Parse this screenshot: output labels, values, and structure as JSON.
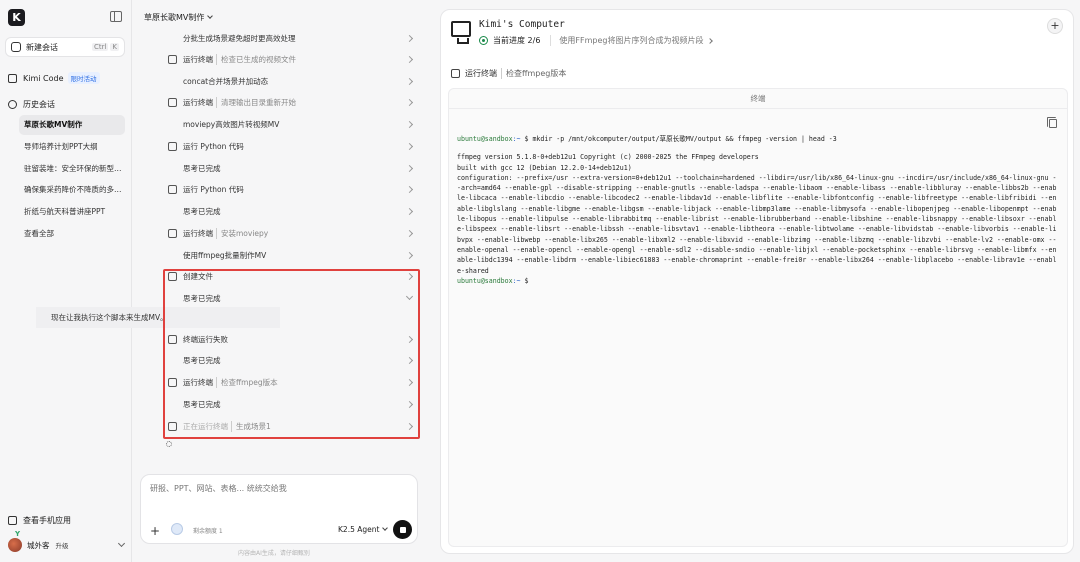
{
  "sidebar": {
    "logo": "K",
    "new_chat": {
      "label": "新建会话",
      "kbd1": "Ctrl",
      "kbd2": "K"
    },
    "kimi_code": {
      "label": "Kimi Code",
      "badge": "限时活动"
    },
    "history_label": "历史会话",
    "history": [
      "草原长歌MV制作",
      "导师培养计划PPT大纲",
      "驻留装堆：安全环保的新型…",
      "确保集采药降价不降质的多…",
      "折纸与航天科普讲座PPT",
      "查看全部"
    ],
    "mobile_app": "查看手机应用",
    "user": {
      "name": "城外客",
      "upgrade": "升级",
      "mark": "Y"
    }
  },
  "chat": {
    "title": "草原长歌MV制作",
    "steps": [
      {
        "icon": "none",
        "text": "分批生成场景避免超时更高效处理",
        "sub": ""
      },
      {
        "icon": "terminal",
        "text": "运行终端",
        "sub": "检查已生成的视频文件"
      },
      {
        "icon": "none",
        "text": "concat合并场景并加动态",
        "sub": ""
      },
      {
        "icon": "terminal",
        "text": "运行终端",
        "sub": "清理输出目录重新开始"
      },
      {
        "icon": "none",
        "text": "moviepy高效图片转视频MV",
        "sub": ""
      },
      {
        "icon": "terminal",
        "text": "运行 Python 代码",
        "sub": ""
      },
      {
        "icon": "none",
        "text": "思考已完成",
        "sub": ""
      },
      {
        "icon": "terminal",
        "text": "运行 Python 代码",
        "sub": ""
      },
      {
        "icon": "none",
        "text": "思考已完成",
        "sub": ""
      },
      {
        "icon": "terminal",
        "text": "运行终端",
        "sub": "安装moviepy"
      },
      {
        "icon": "none",
        "text": "使用ffmpeg批量制作MV",
        "sub": ""
      },
      {
        "icon": "file",
        "text": "创建文件",
        "sub": ""
      },
      {
        "icon": "none",
        "text": "思考已完成",
        "sub": "",
        "expanded": true
      },
      {
        "icon": "terminal",
        "text": "终端运行失败",
        "sub": ""
      },
      {
        "icon": "none",
        "text": "思考已完成",
        "sub": ""
      },
      {
        "icon": "terminal",
        "text": "运行终端",
        "sub": "检查ffmpeg版本"
      },
      {
        "icon": "none",
        "text": "思考已完成",
        "sub": ""
      },
      {
        "icon": "terminal",
        "text": "正在运行终端",
        "sub": "生成场景1",
        "faded": true
      }
    ],
    "thought_text": "现在让我执行这个脚本来生成MV。",
    "composer": {
      "placeholder": "研报、PPT、网站、表格... 统统交给我",
      "quota": "剩余额度 1",
      "agent": "K2.5 Agent"
    },
    "disclaimer": "内容由AI生成，请仔细甄别"
  },
  "computer": {
    "title": "Kimi's Computer",
    "progress_label": "当前进度 2/6",
    "progress_desc": "使用FFmpeg将图片序列合成为视频片段",
    "tool": {
      "name": "运行终端",
      "sub": "检查ffmpeg版本"
    },
    "terminal_title": "终端",
    "prompt_user": "ubuntu@sandbox",
    "prompt_path": ":~",
    "command": "$ mkdir -p /mnt/okcomputer/output/草原长歌MV/output && ffmpeg -version | head -3",
    "output": [
      "ffmpeg version 5.1.8-0+deb12u1 Copyright (c) 2000-2025 the FFmpeg developers",
      "built with gcc 12 (Debian 12.2.0-14+deb12u1)",
      "configuration: --prefix=/usr --extra-version=0+deb12u1 --toolchain=hardened --libdir=/usr/lib/x86_64-linux-gnu --incdir=/usr/include/x86_64-linux-gnu --arch=amd64 --enable-gpl --disable-stripping --enable-gnutls --enable-ladspa --enable-libaom --enable-libass --enable-libbluray --enable-libbs2b --enable-libcaca --enable-libcdio --enable-libcodec2 --enable-libdav1d --enable-libflite --enable-libfontconfig --enable-libfreetype --enable-libfribidi --enable-libglslang --enable-libgme --enable-libgsm --enable-libjack --enable-libmp3lame --enable-libmysofa --enable-libopenjpeg --enable-libopenmpt --enable-libopus --enable-libpulse --enable-librabbitmq --enable-librist --enable-librubberband --enable-libshine --enable-libsnappy --enable-libsoxr --enable-libspeex --enable-libsrt --enable-libssh --enable-libsvtav1 --enable-libtheora --enable-libtwolame --enable-libvidstab --enable-libvorbis --enable-libvpx --enable-libwebp --enable-libx265 --enable-libxml2 --enable-libxvid --enable-libzimg --enable-libzmq --enable-libzvbi --enable-lv2 --enable-omx --enable-openal --enable-opencl --enable-opengl --enable-sdl2 --disable-sndio --enable-libjxl --enable-pocketsphinx --enable-librsvg --enable-libmfx --enable-libdc1394 --enable-libdrm --enable-libiec61883 --enable-chromaprint --enable-frei0r --enable-libx264 --enable-libplacebo --enable-librav1e --enable-shared"
    ],
    "final_prompt": "$"
  }
}
